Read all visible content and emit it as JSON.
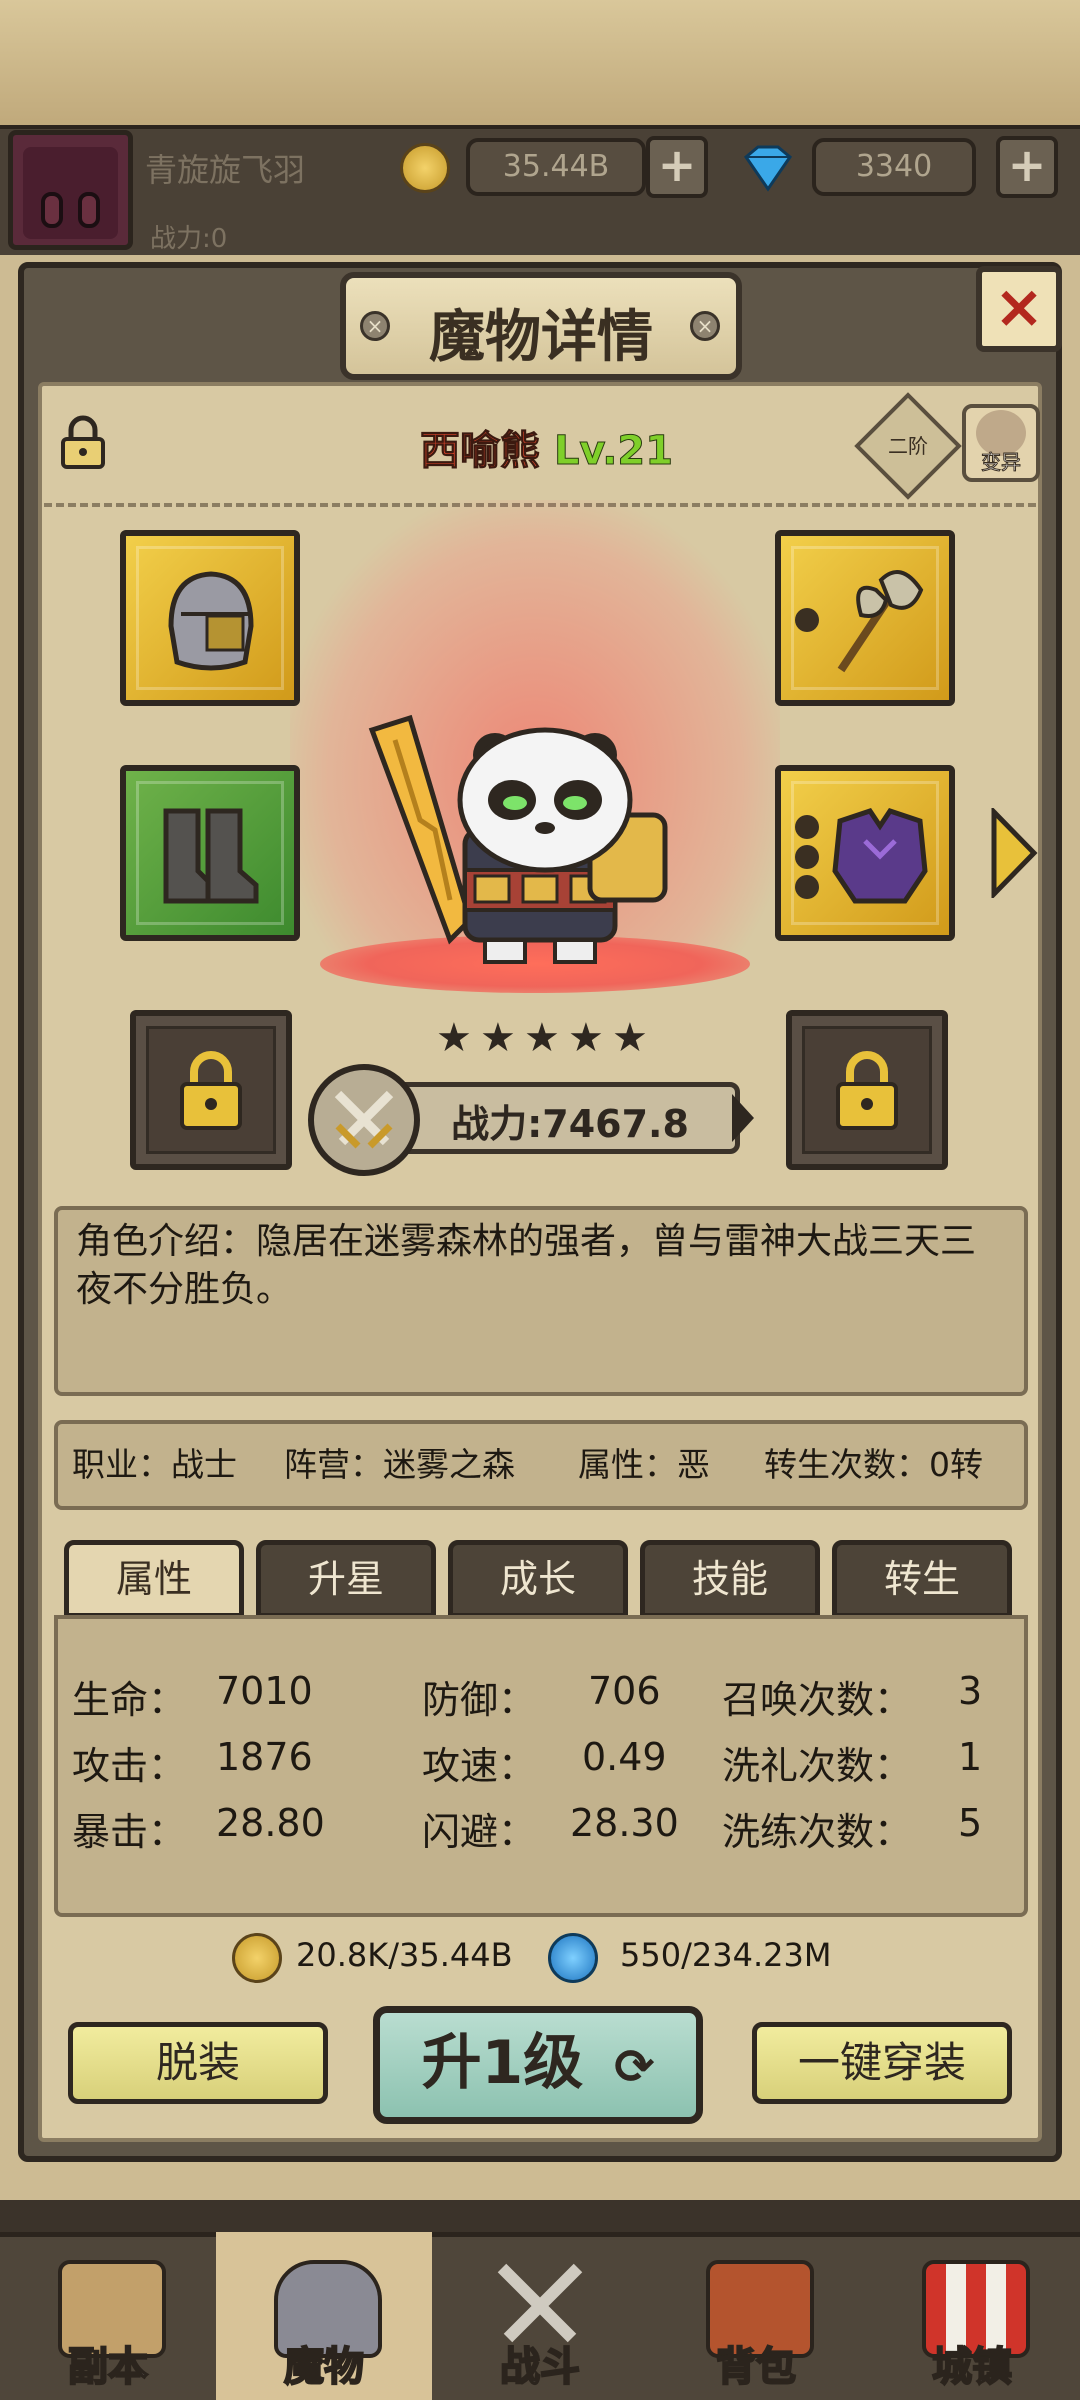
{
  "header": {
    "player_name": "青旋旋飞羽",
    "player_power": "战力:0",
    "gold": "35.44B",
    "gems": "3340",
    "plus": "+"
  },
  "panel": {
    "title": "魔物详情",
    "close": "×",
    "monster_name": "西喻熊",
    "monster_level": "Lv.21",
    "tier": "二阶",
    "mutate": "变异",
    "stars": 5,
    "power": "战力:7467.8",
    "description": "角色介绍：隐居在迷雾森林的强者，曾与雷神大战三天三夜不分胜负。",
    "info": {
      "job": "职业：战士",
      "camp": "阵营：迷雾之森",
      "attribute": "属性：恶",
      "rebirth": "转生次数：0转"
    }
  },
  "tabs": [
    "属性",
    "升星",
    "成长",
    "技能",
    "转生"
  ],
  "stats": {
    "hp_label": "生命：",
    "hp": "7010",
    "def_label": "防御：",
    "def": "706",
    "summon_label": "召唤次数：",
    "summon": "3",
    "atk_label": "攻击：",
    "atk": "1876",
    "spd_label": "攻速：",
    "spd": "0.49",
    "bapt_label": "洗礼次数：",
    "bapt": "1",
    "crit_label": "暴击：",
    "crit": "28.80",
    "dodge_label": "闪避：",
    "dodge": "28.30",
    "refine_label": "洗练次数：",
    "refine": "5"
  },
  "costs": {
    "gold": "20.8K/35.44B",
    "essence": "550/234.23M"
  },
  "buttons": {
    "unequip": "脱装",
    "level_up": "升1级",
    "equip_all": "一键穿装"
  },
  "nav": [
    "副本",
    "魔物",
    "战斗",
    "背包",
    "城镇"
  ],
  "colors": {
    "panel_bg": "#d8c9a3",
    "gold_slot": "#e8b832",
    "green_slot": "#55a03c",
    "name_red": "#e0452a",
    "level_green": "#7fcf2a"
  }
}
